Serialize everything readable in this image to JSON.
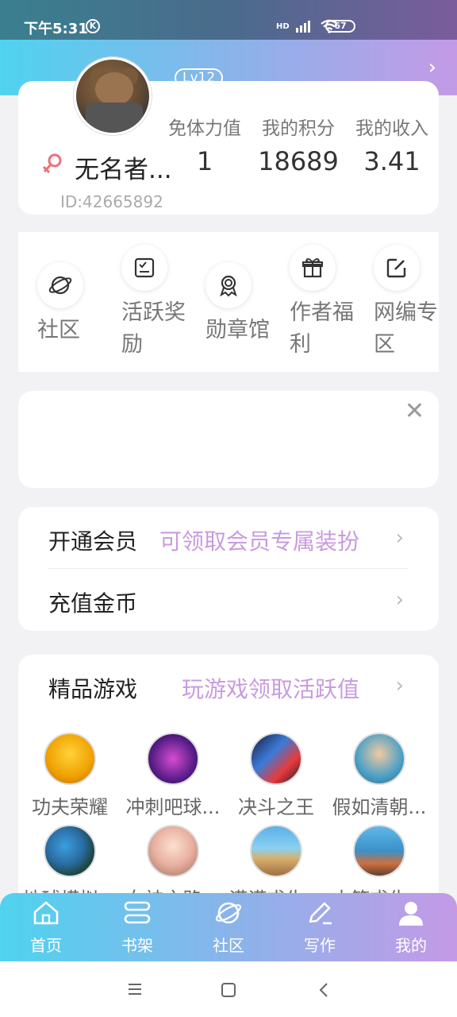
{
  "status_bar": {
    "time": "下午5:31",
    "k_icon": "K",
    "network": "HD",
    "battery": "67"
  },
  "profile": {
    "level": "Lv12",
    "username": "无名者...",
    "user_id": "ID:42665892",
    "stats": [
      {
        "label": "免体力值",
        "value": "1"
      },
      {
        "label": "我的积分",
        "value": "18689"
      },
      {
        "label": "我的收入",
        "value": "3.41"
      }
    ]
  },
  "shortcuts": [
    {
      "label": "社区",
      "icon": "planet-icon"
    },
    {
      "label": "活跃奖励",
      "icon": "checklist-icon"
    },
    {
      "label": "勋章馆",
      "icon": "medal-icon"
    },
    {
      "label": "作者福利",
      "icon": "gift-icon"
    },
    {
      "label": "网编专区",
      "icon": "edit-icon"
    }
  ],
  "vip": {
    "open_title": "开通会员",
    "open_sub": "可领取会员专属装扮",
    "recharge_title": "充值金币"
  },
  "games": {
    "title": "精品游戏",
    "subtitle": "玩游戏领取活跃值",
    "items": [
      {
        "name": "功夫荣耀"
      },
      {
        "name": "冲刺吧球..."
      },
      {
        "name": "决斗之王"
      },
      {
        "name": "假如清朝..."
      },
      {
        "name": "地球模拟..."
      },
      {
        "name": "女神之路..."
      },
      {
        "name": "漠漠求生..."
      },
      {
        "name": "木筏求生..."
      }
    ]
  },
  "bottom_nav": [
    {
      "label": "首页"
    },
    {
      "label": "书架"
    },
    {
      "label": "社区"
    },
    {
      "label": "写作"
    },
    {
      "label": "我的"
    }
  ],
  "colors": {
    "accent_purple": "#c99ae0",
    "gradient_start": "#4fd3ef",
    "gradient_end": "#c49ae6"
  }
}
